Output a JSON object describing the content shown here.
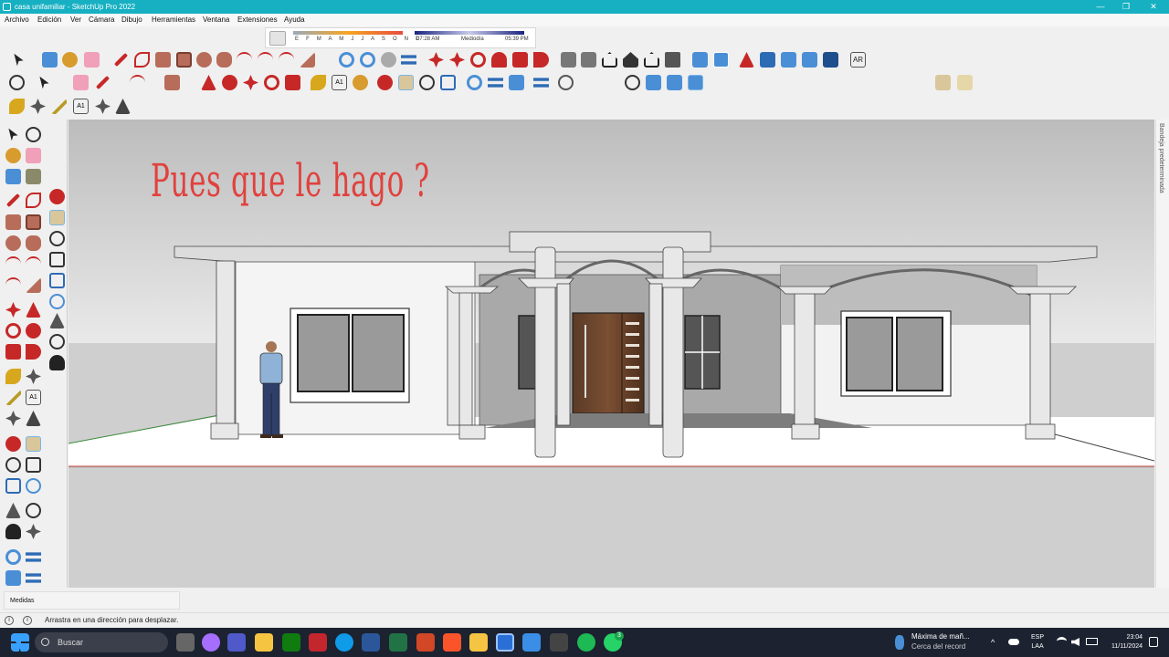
{
  "window": {
    "title": "casa unifamiliar - SketchUp Pro 2022",
    "controls": [
      "minimize-icon",
      "restore-icon",
      "close-icon"
    ]
  },
  "menu": [
    "Archivo",
    "Edición",
    "Ver",
    "Cámara",
    "Dibujo",
    "Herramientas",
    "Ventana",
    "Extensiones",
    "Ayuda"
  ],
  "shadows": {
    "months": "E F M A M J J A S O N D",
    "time_start": "07:28 AM",
    "time_mid": "Mediodía",
    "time_end": "05:39 PM"
  },
  "viewport": {
    "annotation": "Pues que le hago ?",
    "annotation_color": "#e0423e",
    "sky_color": "#dcdcdc",
    "ground_color": "#cfcfcf"
  },
  "right_panel": {
    "label": "Bandeja predeterminada"
  },
  "measurements": {
    "label": "Medidas"
  },
  "status": {
    "hint": "Arrastra en una dirección para desplazar."
  },
  "taskbar": {
    "search_placeholder": "Buscar",
    "weather_title": "Máxima de mañ...",
    "weather_sub": "Cerca del record",
    "lang_1": "ESP",
    "lang_2": "LAA",
    "time": "23:04",
    "date": "11/11/2024",
    "badge_count": "3"
  }
}
